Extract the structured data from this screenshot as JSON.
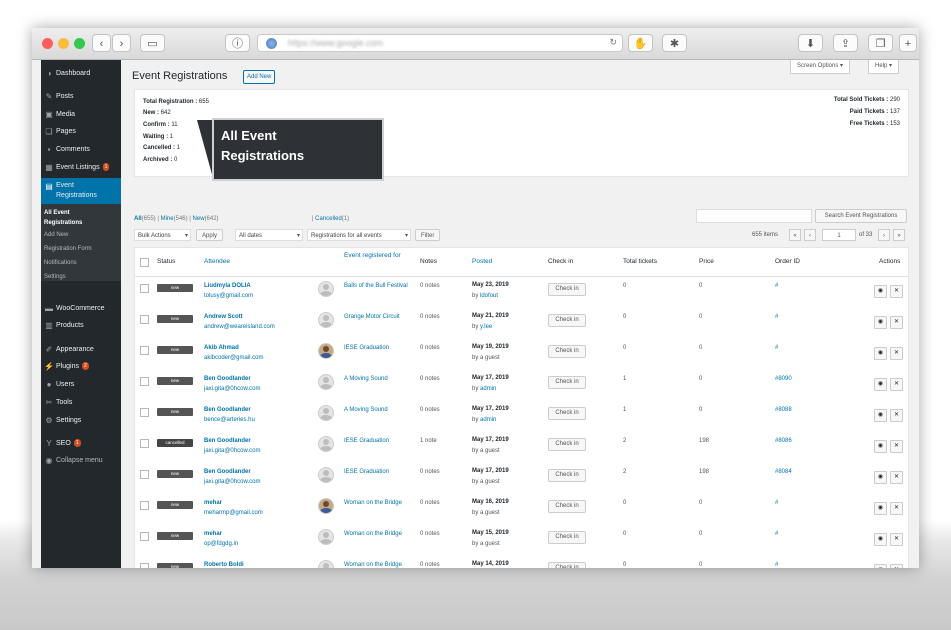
{
  "browser": {
    "url": "https://www.google.com"
  },
  "sidebar": {
    "items": [
      {
        "label": "Dashboard",
        "icon": "dashboard-icon"
      },
      {
        "label": "Posts",
        "icon": "pin-icon"
      },
      {
        "label": "Media",
        "icon": "media-icon"
      },
      {
        "label": "Pages",
        "icon": "pages-icon"
      },
      {
        "label": "Comments",
        "icon": "comments-icon"
      },
      {
        "label": "Event Listings",
        "icon": "calendar-icon",
        "badge": "1"
      },
      {
        "label": "Event Registrations",
        "icon": "registration-icon"
      },
      {
        "label": "WooCommerce",
        "icon": "woocommerce-icon"
      },
      {
        "label": "Products",
        "icon": "products-icon"
      },
      {
        "label": "Appearance",
        "icon": "appearance-icon"
      },
      {
        "label": "Plugins",
        "icon": "plugins-icon",
        "badge": "2"
      },
      {
        "label": "Users",
        "icon": "users-icon"
      },
      {
        "label": "Tools",
        "icon": "tools-icon"
      },
      {
        "label": "Settings",
        "icon": "settings-icon"
      },
      {
        "label": "SEO",
        "icon": "seo-icon",
        "badge": "1"
      },
      {
        "label": "Collapse menu",
        "icon": "collapse-icon"
      }
    ],
    "submenu": [
      "All Event Registrations",
      "Add New",
      "Registration Form",
      "Notifications",
      "Settings"
    ]
  },
  "header": {
    "title": "Event Registrations",
    "add_new": "Add New",
    "screen_options": "Screen Options ▾",
    "help": "Help ▾"
  },
  "stats": {
    "left": [
      {
        "k": "Total Registration :",
        "v": "655"
      },
      {
        "k": "New :",
        "v": "642"
      },
      {
        "k": "Confirm :",
        "v": "11"
      },
      {
        "k": "Waiting :",
        "v": "1"
      },
      {
        "k": "Cancelled :",
        "v": "1"
      },
      {
        "k": "Archived :",
        "v": "0"
      }
    ],
    "right": [
      {
        "k": "Total Sold Tickets :",
        "v": "290"
      },
      {
        "k": "Paid Tickets :",
        "v": "137"
      },
      {
        "k": "Free Tickets :",
        "v": "153"
      }
    ]
  },
  "tooltip": {
    "line1": "All Event",
    "line2": "Registrations"
  },
  "filters": {
    "all": "All",
    "all_count": "(655)",
    "mine": "Mine",
    "mine_count": "(546)",
    "new": "New",
    "new_count": "(642)",
    "cancelled": "Cancelled",
    "cancelled_count": "(1)"
  },
  "search": {
    "button": "Search Event Registrations"
  },
  "toolbar": {
    "bulk": "Bulk Actions",
    "apply": "Apply",
    "dates": "All dates",
    "events": "Registrations for all events",
    "filter": "Filter",
    "items": "655 items",
    "first": "«",
    "prev": "‹",
    "page": "1",
    "of": "of 33",
    "next": "›",
    "last": "»"
  },
  "table": {
    "headers": {
      "status": "Status",
      "attendee": "Attendee",
      "event": "Event registered for",
      "notes": "Notes",
      "posted": "Posted",
      "checkin": "Check in",
      "tickets": "Total tickets",
      "price": "Price",
      "order": "Order ID",
      "actions": "Actions"
    },
    "rows": [
      {
        "status": "new",
        "name": "Liudmyla DOLIA",
        "email": "tolusy@gmail.com",
        "event": "Balls of the Bull Festival",
        "notes": "0 notes",
        "date": "May 23, 2019",
        "by_prefix": "by",
        "by": "ldofout",
        "checkin": "Check in",
        "tickets": "0",
        "price": "0",
        "order": "#",
        "avatar": "default"
      },
      {
        "status": "new",
        "name": "Andrew Scott",
        "email": "andrew@weareisland.com",
        "event": "Grange Motor Circuit",
        "notes": "0 notes",
        "date": "May 21, 2019",
        "by_prefix": "by",
        "by": "y.lee",
        "checkin": "Check in",
        "tickets": "0",
        "price": "0",
        "order": "#",
        "avatar": "default"
      },
      {
        "status": "new",
        "name": "Akib Ahmad",
        "email": "akibcoder@gmail.com",
        "event": "IESE Graduation",
        "notes": "0 notes",
        "date": "May 19, 2019",
        "by_prefix": "by a guest",
        "by": "",
        "checkin": "Check in",
        "tickets": "0",
        "price": "0",
        "order": "#",
        "avatar": "photo"
      },
      {
        "status": "new",
        "name": "Ben Goodlander",
        "email": "jaxi.gita@0hcow.com",
        "event": "A Moving Sound",
        "notes": "0 notes",
        "date": "May 17, 2019",
        "by_prefix": "by",
        "by": "admin",
        "checkin": "Check in",
        "tickets": "1",
        "price": "0",
        "order": "#8090",
        "avatar": "default"
      },
      {
        "status": "new",
        "name": "Ben Goodlander",
        "email": "bence@arteries.hu",
        "event": "A Moving Sound",
        "notes": "0 notes",
        "date": "May 17, 2019",
        "by_prefix": "by",
        "by": "admin",
        "checkin": "Check in",
        "tickets": "1",
        "price": "0",
        "order": "#8088",
        "avatar": "default"
      },
      {
        "status": "cancelled",
        "name": "Ben Goodlander",
        "email": "jaxi.gita@0hcow.com",
        "event": "IESE Graduation",
        "notes": "1 note",
        "date": "May 17, 2019",
        "by_prefix": "by a guest",
        "by": "",
        "checkin": "Check in",
        "tickets": "2",
        "price": "198",
        "order": "#8086",
        "avatar": "default"
      },
      {
        "status": "new",
        "name": "Ben Goodlander",
        "email": "jaxi.gita@0hcow.com",
        "event": "IESE Graduation",
        "notes": "0 notes",
        "date": "May 17, 2019",
        "by_prefix": "by a guest",
        "by": "",
        "checkin": "Check in",
        "tickets": "2",
        "price": "198",
        "order": "#8084",
        "avatar": "default"
      },
      {
        "status": "new",
        "name": "mehar",
        "email": "meharmp@gmail.com",
        "event": "Woman on the Bridge",
        "notes": "0 notes",
        "date": "May 16, 2019",
        "by_prefix": "by a guest",
        "by": "",
        "checkin": "Check in",
        "tickets": "0",
        "price": "0",
        "order": "#",
        "avatar": "photo"
      },
      {
        "status": "new",
        "name": "mehar",
        "email": "op@fdgdg.in",
        "event": "Woman on the Bridge",
        "notes": "0 notes",
        "date": "May 15, 2019",
        "by_prefix": "by a guest",
        "by": "",
        "checkin": "Check in",
        "tickets": "0",
        "price": "0",
        "order": "#",
        "avatar": "default"
      },
      {
        "status": "new",
        "name": "Roberto Boldi",
        "email": "roberto.boldi@gmail.com",
        "event": "Woman on the Bridge",
        "notes": "0 notes",
        "date": "May 14, 2019",
        "by_prefix": "by a guest",
        "by": "",
        "checkin": "Check in",
        "tickets": "0",
        "price": "0",
        "order": "#",
        "avatar": "default"
      }
    ]
  },
  "colors": {
    "accent": "#0073aa",
    "sidebar": "#23282d",
    "badge": "#d54e21"
  }
}
